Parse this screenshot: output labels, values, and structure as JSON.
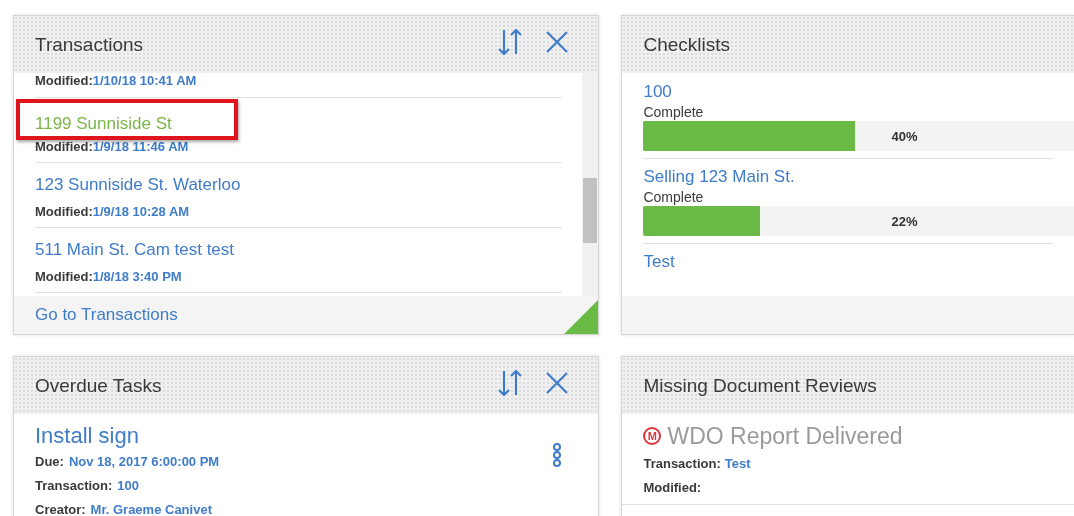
{
  "transactions": {
    "title": "Transactions",
    "items": [
      {
        "modified_label": "Modified:",
        "modified": "1/10/18 10:41 AM"
      },
      {
        "name": "1199 Sunniside St",
        "modified_label": "Modified:",
        "modified": "1/9/18 11:46 AM",
        "highlighted": true
      },
      {
        "name": "123 Sunniside St. Waterloo",
        "modified_label": "Modified:",
        "modified": "1/9/18 10:28 AM",
        "highlighted": false
      },
      {
        "name": "511 Main St. Cam test test",
        "modified_label": "Modified:",
        "modified": "1/8/18 3:40 PM",
        "highlighted": false
      }
    ],
    "footer_link": "Go to Transactions"
  },
  "checklists": {
    "title": "Checklists",
    "items": [
      {
        "name": "100",
        "status": "Complete",
        "level": 0.4,
        "reading": "40%"
      },
      {
        "name": "Selling 123 Main St.",
        "status": "Complete",
        "level": 0.22,
        "reading": "22%"
      },
      {
        "name": "Test"
      }
    ]
  },
  "overdue_tasks": {
    "title": "Overdue Tasks",
    "tasks": [
      {
        "title": "Install sign",
        "fields": [
          {
            "label": "Due:",
            "value": "Nov 18, 2017 6:00:00 PM"
          },
          {
            "label": "Transaction:",
            "value": "100"
          },
          {
            "label": "Creator:",
            "value": "Mr. Graeme Canivet"
          }
        ]
      }
    ]
  },
  "missing_document_reviews": {
    "title": "Missing Document Reviews",
    "items": [
      {
        "badge": "M",
        "title": "WDO Report Delivered",
        "fields": [
          {
            "label": "Transaction:",
            "value": "Test"
          },
          {
            "label": "Modified:"
          }
        ]
      }
    ]
  }
}
